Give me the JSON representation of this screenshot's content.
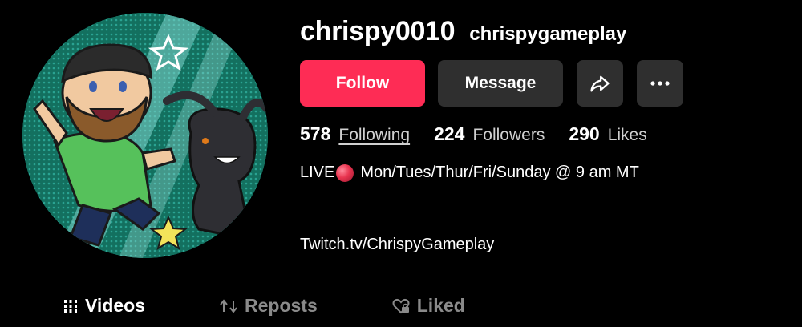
{
  "profile": {
    "username": "chrispy0010",
    "nickname": "chrispygameplay"
  },
  "actions": {
    "follow_label": "Follow",
    "message_label": "Message",
    "share_icon": "share-arrow-icon",
    "more_icon": "more-dots-icon"
  },
  "stats": {
    "following_count": "578",
    "following_label": "Following",
    "followers_count": "224",
    "followers_label": "Followers",
    "likes_count": "290",
    "likes_label": "Likes"
  },
  "bio": {
    "live_prefix": "LIVE",
    "live_icon": "red-circle-icon",
    "schedule": "Mon/Tues/Thur/Fri/Sunday @ 9 am MT",
    "link": "Twitch.tv/ChrispyGameplay"
  },
  "tabs": [
    {
      "label": "Videos",
      "icon": "grid-bars-icon",
      "active": true
    },
    {
      "label": "Reposts",
      "icon": "repost-icon",
      "active": false
    },
    {
      "label": "Liked",
      "icon": "heart-lock-icon",
      "active": false
    }
  ],
  "colors": {
    "follow_button": "#fe2c55",
    "secondary_button": "#2f2f2f",
    "background": "#000000",
    "inactive_tab": "#8a8a8a"
  }
}
